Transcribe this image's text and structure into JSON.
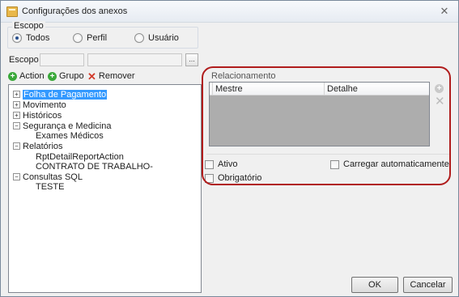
{
  "window": {
    "title": "Configurações dos anexos",
    "close_glyph": "✕"
  },
  "scope_group": {
    "label": "Escopo",
    "options": [
      {
        "label": "Todos",
        "selected": true
      },
      {
        "label": "Perfil",
        "selected": false
      },
      {
        "label": "Usuário",
        "selected": false
      }
    ]
  },
  "scope_row": {
    "label": "Escopo",
    "ellipsis": "..."
  },
  "toolbar": {
    "action_label": "Action",
    "group_label": "Grupo",
    "remove_label": "Remover"
  },
  "tree": {
    "items": [
      {
        "label": "Folha de Pagamento",
        "expander": "+",
        "selected": true
      },
      {
        "label": "Movimento",
        "expander": "+"
      },
      {
        "label": "Históricos",
        "expander": "+"
      },
      {
        "label": "Segurança e Medicina",
        "expander": "−"
      },
      {
        "label": "Exames Médicos"
      },
      {
        "label": "Relatórios",
        "expander": "−"
      },
      {
        "label": "RptDetailReportAction"
      },
      {
        "label": "CONTRATO DE TRABALHO-"
      },
      {
        "label": "Consultas SQL",
        "expander": "−"
      },
      {
        "label": "TESTE"
      }
    ]
  },
  "relationship": {
    "title": "Relacionamento",
    "columns": [
      "Mestre",
      "Detalhe"
    ],
    "active_label": "Ativo",
    "required_label": "Obrigatório",
    "autoload_label": "Carregar automaticamente"
  },
  "buttons": {
    "ok": "OK",
    "cancel": "Cancelar"
  },
  "colors": {
    "highlight": "#b01c1c",
    "selection": "#3399ff",
    "grid_bg": "#adadad"
  }
}
